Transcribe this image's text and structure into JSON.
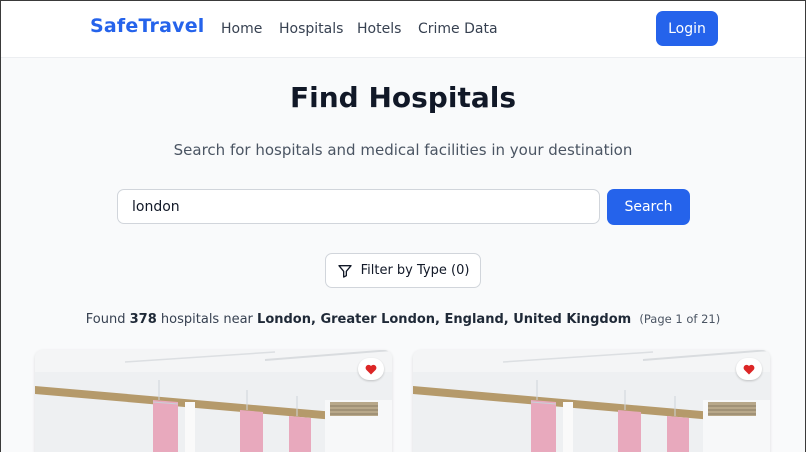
{
  "brand": "SafeTravel",
  "nav": {
    "links": [
      "Home",
      "Hospitals",
      "Hotels",
      "Crime Data"
    ],
    "login": "Login"
  },
  "hero": {
    "title": "Find Hospitals",
    "subtitle": "Search for hospitals and medical facilities in your destination"
  },
  "search": {
    "value": "london",
    "button": "Search"
  },
  "filter": {
    "label": "Filter by Type (0)",
    "icon": "filter-icon"
  },
  "results": {
    "prefix": "Found",
    "count": "378",
    "middle": "hospitals near",
    "location": "London, Greater London, England, United Kingdom",
    "page_info": "(Page 1 of 21)"
  },
  "cards": [
    {
      "favorite": true,
      "icon": "heart-icon"
    },
    {
      "favorite": true,
      "icon": "heart-icon"
    }
  ],
  "colors": {
    "accent": "#2563eb",
    "heart": "#dc2626",
    "curtain": "#e8a9bd"
  }
}
